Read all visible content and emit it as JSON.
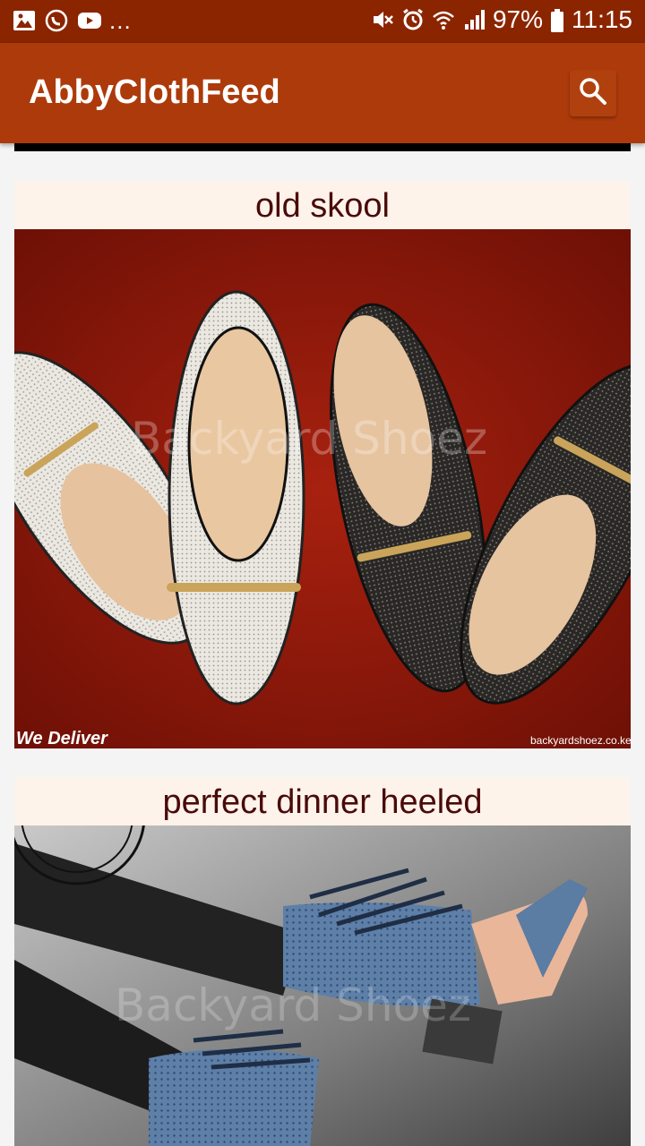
{
  "status_bar": {
    "battery": "97%",
    "time": "11:15",
    "more": "...",
    "icons": [
      "gallery-icon",
      "whatsapp-icon",
      "youtube-icon",
      "mute-icon",
      "alarm-icon",
      "wifi-icon",
      "signal-icon",
      "battery-icon"
    ]
  },
  "app_bar": {
    "title": "AbbyClothFeed",
    "search_icon": "search-icon"
  },
  "feed": [
    {
      "title": "old skool",
      "image": {
        "watermark": "Backyard Shoez",
        "footer_left": "We Deliver",
        "footer_right": "backyardshoez.co.ke"
      }
    },
    {
      "title": "perfect dinner heeled",
      "image": {
        "watermark": "Backyard Shoez"
      }
    }
  ],
  "colors": {
    "status_bar": "#8b2500",
    "app_bar": "#ad3a0a",
    "card_title_bg": "#fdf3ea",
    "card_title_text": "#4a0a0a"
  }
}
